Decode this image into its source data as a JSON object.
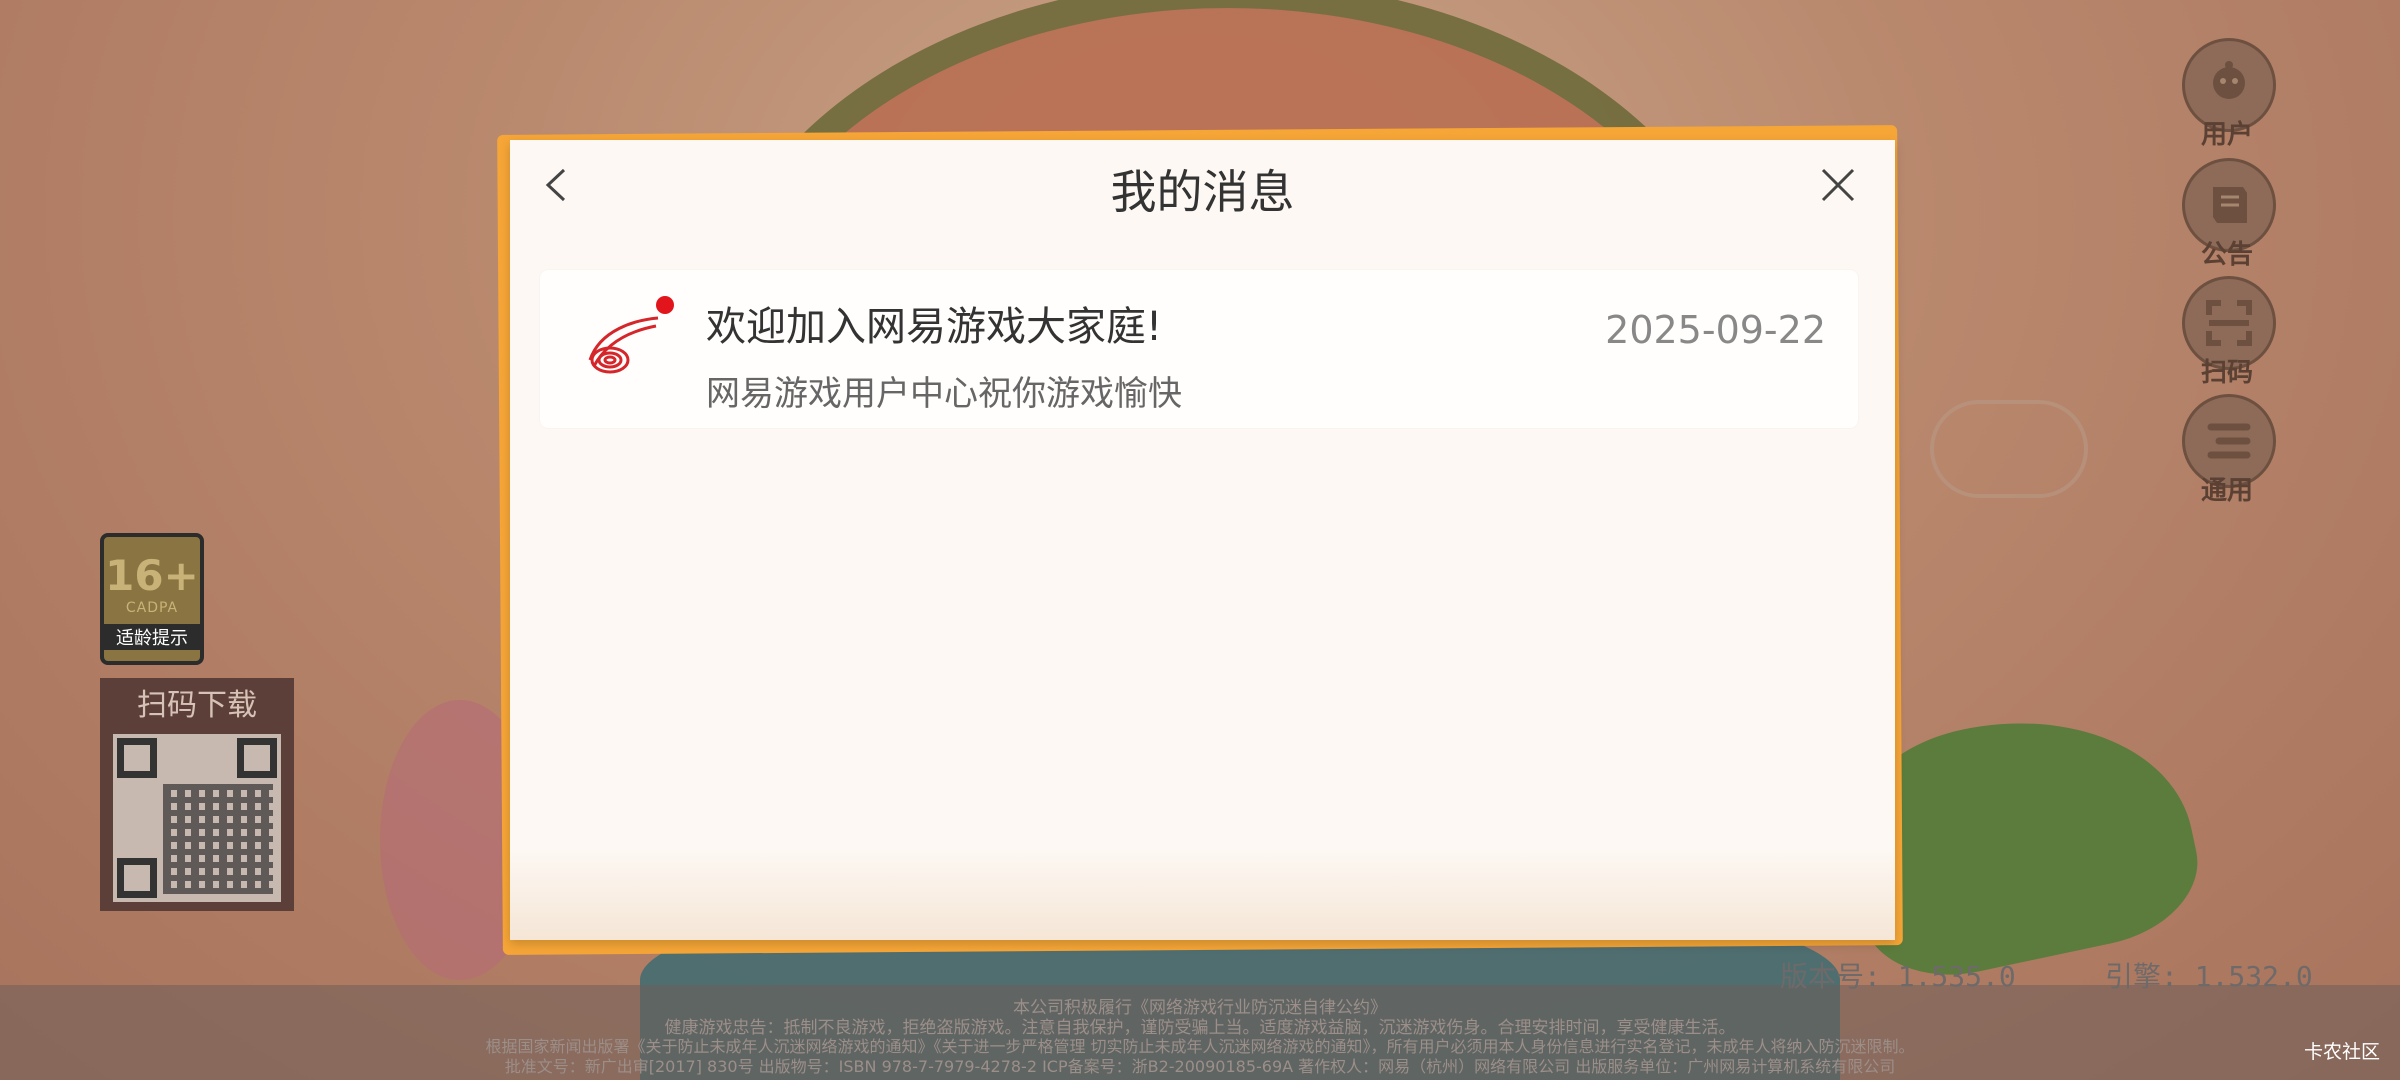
{
  "modal": {
    "title": "我的消息",
    "messages": [
      {
        "title": "欢迎加入网易游戏大家庭!",
        "subtitle": "网易游戏用户中心祝你游戏愉快",
        "date": "2025-09-22",
        "unread": true
      }
    ]
  },
  "side_menu": [
    {
      "label": "用户",
      "icon": "user-icon"
    },
    {
      "label": "公告",
      "icon": "notice-icon"
    },
    {
      "label": "扫码",
      "icon": "scan-icon"
    },
    {
      "label": "通用",
      "icon": "settings-icon"
    }
  ],
  "age_badge": {
    "rating": "16+",
    "org": "CADPA",
    "tip": "适龄提示"
  },
  "qr_download": {
    "title": "扫码下载"
  },
  "footer": {
    "version": "版本号: 1.535.0",
    "engine": "引擎: 1.532.0",
    "notice_lines": [
      "本公司积极履行《网络游戏行业防沉迷自律公约》",
      "健康游戏忠告：抵制不良游戏，拒绝盗版游戏。注意自我保护，谨防受骗上当。适度游戏益脑，沉迷游戏伤身。合理安排时间，享受健康生活。",
      "根据国家新闻出版署《关于防止未成年人沉迷网络游戏的通知》《关于进一步严格管理 切实防止未成年人沉迷网络游戏的通知》，所有用户必须用本人身份信息进行实名登记，未成年人将纳入防沉迷限制。",
      "批准文号：新广出审[2017] 830号 出版物号：ISBN 978-7-7979-4278-2 ICP备案号：浙B2-20090185-69A 著作权人：网易（杭州）网络有限公司 出版服务单位：广州网易计算机系统有限公司"
    ],
    "community": "卡农社区"
  }
}
